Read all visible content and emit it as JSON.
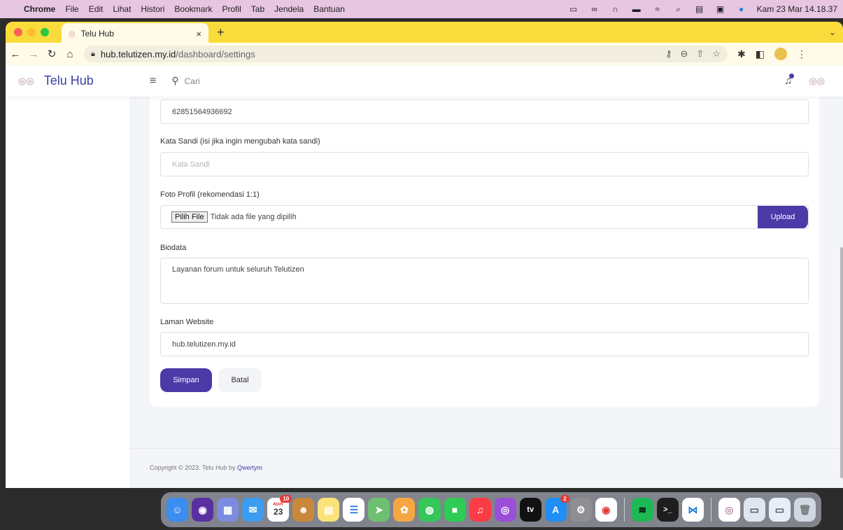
{
  "menubar": {
    "app": "Chrome",
    "items": [
      "File",
      "Edit",
      "Lihat",
      "Histori",
      "Bookmark",
      "Profil",
      "Tab",
      "Jendela",
      "Bantuan"
    ],
    "clock": "Kam 23 Mar  14.18.37"
  },
  "tab": {
    "title": "Telu Hub",
    "close": "×",
    "new": "+"
  },
  "address": {
    "host": "hub.telutizen.my.id",
    "path": "/dashboard/settings"
  },
  "app": {
    "brand": "Telu Hub",
    "search_placeholder": "Cari"
  },
  "form": {
    "phone_value": "62851564936692",
    "password_label": "Kata Sandi (isi jika ingin mengubah kata sandi)",
    "password_placeholder": "Kata Sandi",
    "photo_label": "Foto Profil (rekomendasi 1:1)",
    "file_button": "Pilih File",
    "file_status": "Tidak ada file yang dipilih",
    "upload_label": "Upload",
    "bio_label": "Biodata",
    "bio_value": "Layanan forum untuk seluruh Telutizen",
    "website_label": "Laman Website",
    "website_value": "hub.telutizen.my.id",
    "save_label": "Simpan",
    "cancel_label": "Batal"
  },
  "footer": {
    "text": "Copyright © 2023. Telu Hub by ",
    "link": "Qwertym"
  },
  "dock": {
    "calendar_month": "MAR",
    "calendar_day": "23",
    "calendar_badge": "10",
    "appstore_badge": "2"
  },
  "colors": {
    "accent": "#4b3aa8",
    "menubar": "#e7c6e2",
    "tabbar": "#f9dc3b"
  }
}
